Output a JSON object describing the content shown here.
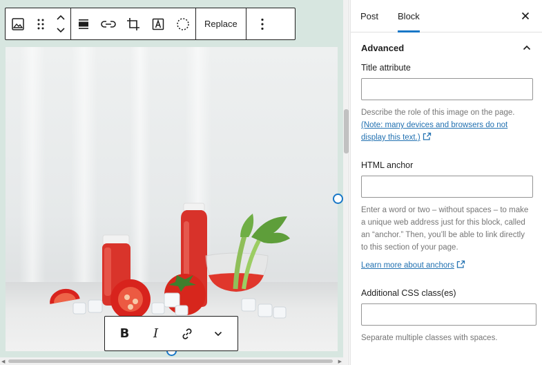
{
  "block_toolbar": {
    "replace_label": "Replace"
  },
  "sidebar": {
    "tabs": [
      {
        "label": "Post"
      },
      {
        "label": "Block"
      }
    ],
    "panel": {
      "title": "Advanced",
      "fields": {
        "title_attribute": {
          "label": "Title attribute",
          "value": "",
          "help": "Describe the role of this image on the page.",
          "link": "(Note: many devices and browsers do not display this text.)"
        },
        "html_anchor": {
          "label": "HTML anchor",
          "value": "",
          "help": "Enter a word or two – without spaces – to make a unique web address just for this block, called an “anchor.” Then, you’ll be able to link directly to this section of your page.",
          "link": "Learn more about anchors"
        },
        "css_classes": {
          "label": "Additional CSS class(es)",
          "value": "",
          "help": "Separate multiple classes with spaces."
        }
      }
    }
  },
  "colors": {
    "accent": "#1877c7",
    "link": "#2271b1",
    "canvas_bg": "#d7e6e0"
  }
}
